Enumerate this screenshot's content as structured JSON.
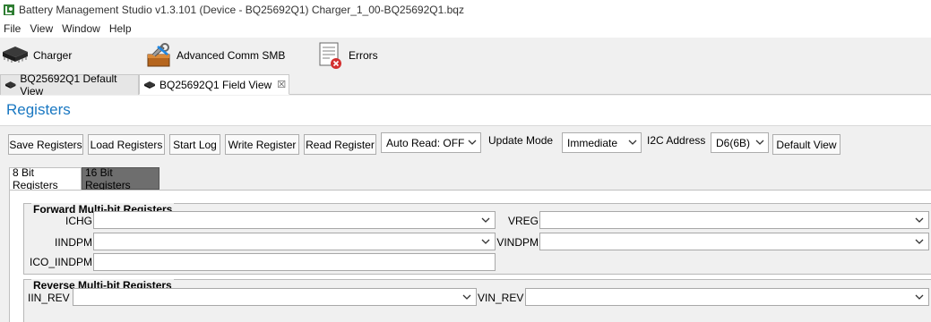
{
  "window": {
    "title": "Battery Management Studio v1.3.101  (Device - BQ25692Q1)  Charger_1_00-BQ25692Q1.bqz"
  },
  "menu": [
    "File",
    "View",
    "Window",
    "Help"
  ],
  "toolbar": {
    "charger": "Charger",
    "advanced_comm": "Advanced Comm SMB",
    "errors": "Errors"
  },
  "view_tabs": {
    "default_view": "BQ25692Q1 Default View",
    "field_view": "BQ25692Q1 Field View"
  },
  "section_title": "Registers",
  "buttons": {
    "save": "Save Registers",
    "load": "Load Registers",
    "start_log": "Start Log",
    "write": "Write Register",
    "read": "Read Register",
    "default_view": "Default View"
  },
  "controls": {
    "auto_read": "Auto Read: OFF",
    "update_mode_label": "Update Mode",
    "update_mode": "Immediate",
    "i2c_label": "I2C Address",
    "i2c_address": "D6(6B)"
  },
  "subtabs": {
    "bit8": "8 Bit Registers",
    "bit16": "16 Bit Registers"
  },
  "forward": {
    "title": "Forward Multi-bit Registers",
    "ichg": "ICHG",
    "iindpm": "IINDPM",
    "ico_iindpm": "ICO_IINDPM",
    "vreg": "VREG",
    "vindpm": "VINDPM"
  },
  "reverse": {
    "title": "Reverse Multi-bit Registers",
    "iin_rev": "IIN_REV",
    "vin_rev": "VIN_REV"
  }
}
